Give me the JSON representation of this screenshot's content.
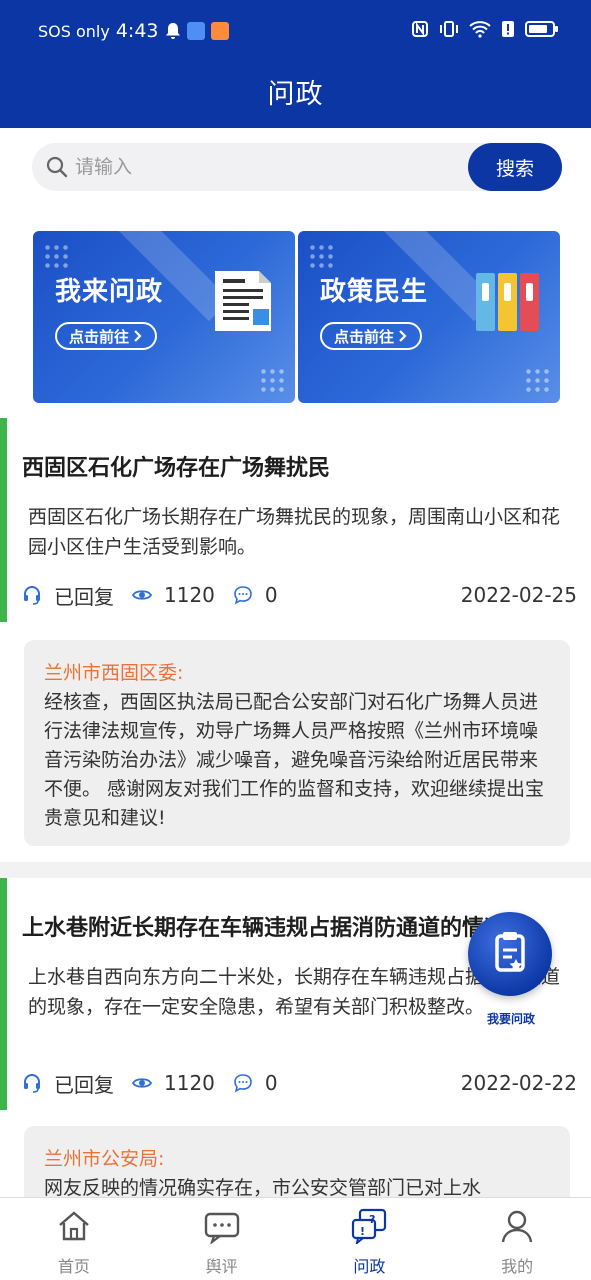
{
  "status_bar": {
    "carrier": "SOS only",
    "time": "4:43"
  },
  "header": {
    "title": "问政"
  },
  "search": {
    "placeholder": "请输入",
    "button_label": "搜索"
  },
  "banners": [
    {
      "title": "我来问政",
      "link_label": "点击前往"
    },
    {
      "title": "政策民生",
      "link_label": "点击前往"
    }
  ],
  "posts": [
    {
      "title": "西固区石化广场存在广场舞扰民",
      "body": "西固区石化广场长期存在广场舞扰民的现象，周围南山小区和花园小区住户生活受到影响。",
      "status": "已回复",
      "views": "1120",
      "comments": "0",
      "date": "2022-02-25",
      "reply_dept": "兰州市西固区委:",
      "reply_text": "经核查，西固区执法局已配合公安部门对石化广场舞人员进行法律法规宣传，劝导广场舞人员严格按照《兰州市环境噪音污染防治办法》减少噪音，避免噪音污染给附近居民带来不便。 感谢网友对我们工作的监督和支持，欢迎继续提出宝贵意见和建议!"
    },
    {
      "title": "上水巷附近长期存在车辆违规占据消防通道的情况",
      "body": "上水巷自西向东方向二十米处，长期存在车辆违规占据消防通道的现象，存在一定安全隐患，希望有关部门积极整改。",
      "status": "已回复",
      "views": "1120",
      "comments": "0",
      "date": "2022-02-22",
      "reply_dept": "兰州市公安局:",
      "reply_text": "网友反映的情况确实存在，市公安交管部门已对上水"
    }
  ],
  "fab": {
    "label": "我要问政"
  },
  "bottom_nav": [
    {
      "label": "首页",
      "icon": "home-icon"
    },
    {
      "label": "舆评",
      "icon": "chat-icon"
    },
    {
      "label": "问政",
      "icon": "question-icon"
    },
    {
      "label": "我的",
      "icon": "user-icon"
    }
  ],
  "colors": {
    "primary": "#0b36a4",
    "accent_green": "#3db54a",
    "reply_orange": "#e8733a"
  }
}
